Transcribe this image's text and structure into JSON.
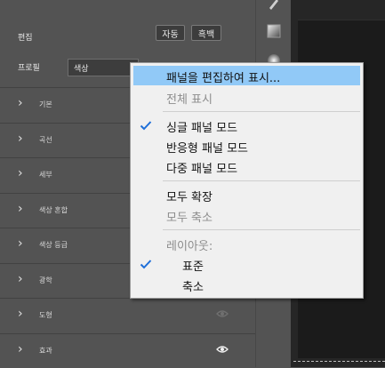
{
  "panel": {
    "edit_title": "편집",
    "auto_button": "자동",
    "bw_button": "흑백",
    "profile_label": "프로필",
    "profile_value": "색상",
    "sections": [
      {
        "label": "기본",
        "eye": false
      },
      {
        "label": "곡선",
        "eye": false
      },
      {
        "label": "세부",
        "eye": false
      },
      {
        "label": "색상 혼합",
        "eye": false
      },
      {
        "label": "색상 등급",
        "eye": false
      },
      {
        "label": "광학",
        "eye": false
      },
      {
        "label": "도형",
        "eye": true,
        "eye_dim": true
      },
      {
        "label": "효과",
        "eye": true,
        "eye_dim": false
      }
    ]
  },
  "toolbar": {
    "tools": [
      "brush-icon",
      "gradient-icon",
      "radial-icon"
    ]
  },
  "menu": {
    "items": [
      {
        "label": "패널을 편집하여 표시...",
        "state": "highlight",
        "checked": false
      },
      {
        "label": "전체 표시",
        "state": "disabled",
        "checked": false
      },
      {
        "label": "싱글 패널 모드",
        "state": "normal",
        "checked": true
      },
      {
        "label": "반응형 패널 모드",
        "state": "normal",
        "checked": false
      },
      {
        "label": "다중 패널 모드",
        "state": "normal",
        "checked": false
      },
      {
        "label": "모두 확장",
        "state": "normal",
        "checked": false
      },
      {
        "label": "모두 축소",
        "state": "disabled",
        "checked": false
      },
      {
        "label": "레이아웃:",
        "state": "disabled",
        "checked": false
      },
      {
        "label": "표준",
        "state": "normal",
        "checked": true
      },
      {
        "label": "축소",
        "state": "normal",
        "checked": false
      }
    ]
  },
  "colors": {
    "menu_highlight": "#91c9f7",
    "check_color": "#1e6fd9",
    "panel_bg": "#535353"
  }
}
